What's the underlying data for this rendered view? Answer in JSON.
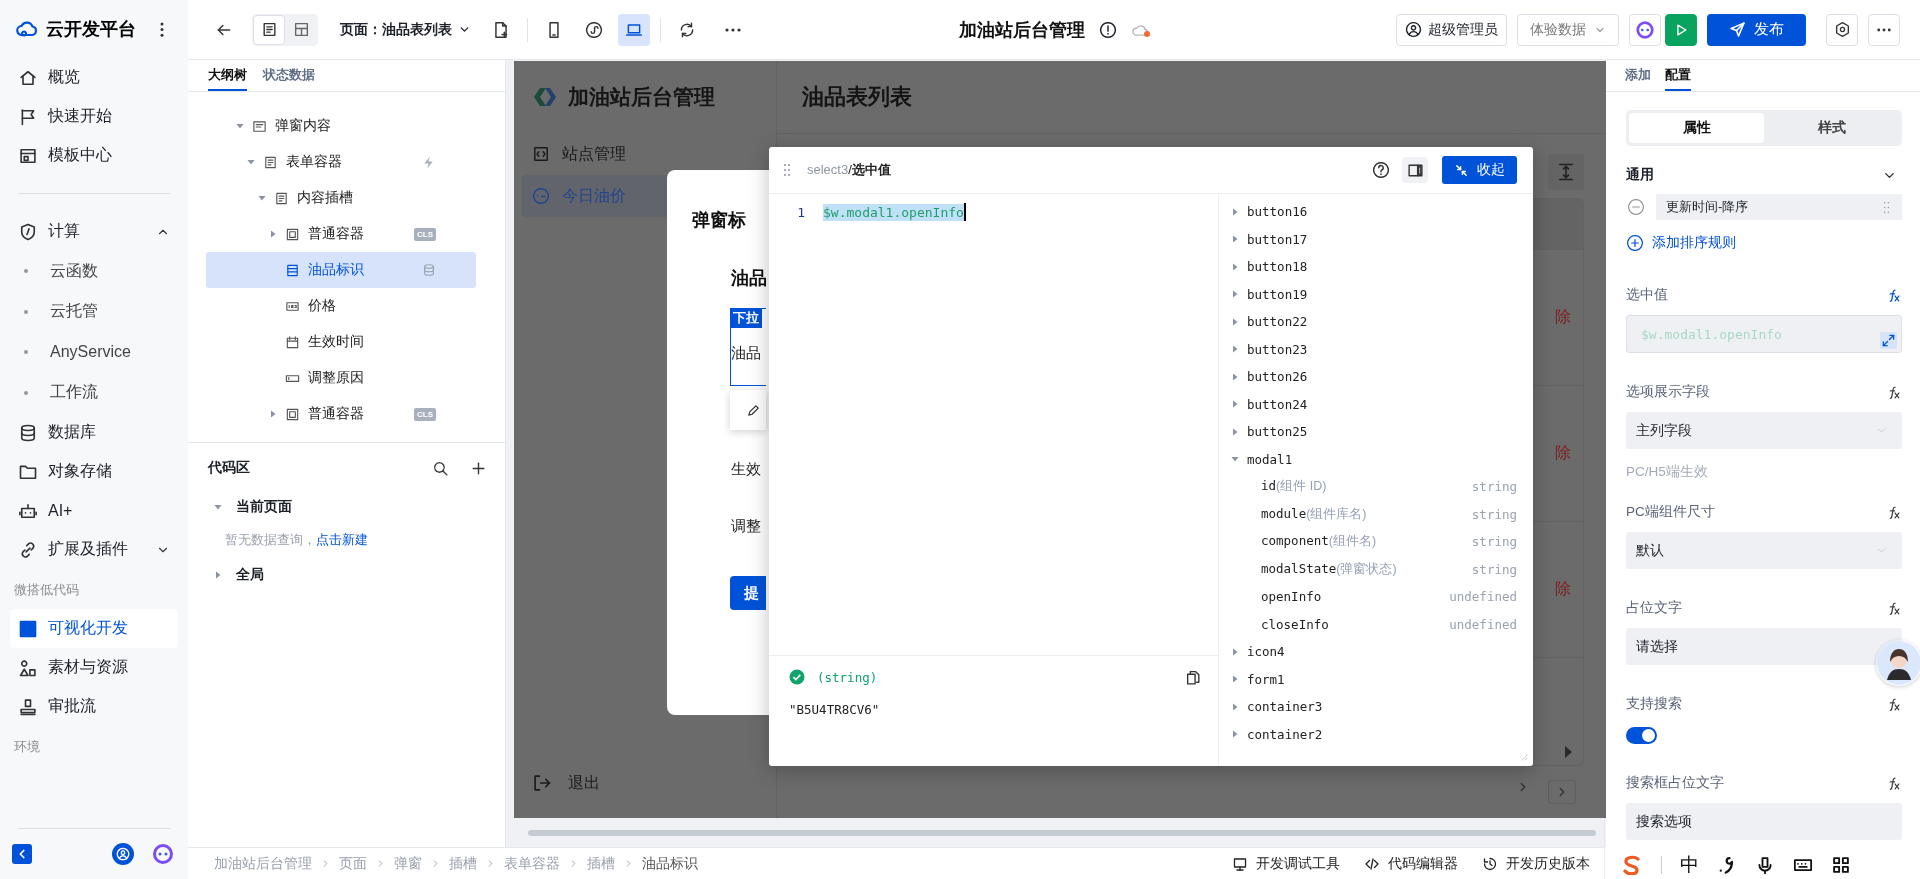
{
  "brand": {
    "name": "云开发平台"
  },
  "nav_top": [
    {
      "label": "概览",
      "selected": false
    },
    {
      "label": "快速开始",
      "selected": false
    },
    {
      "label": "模板中心",
      "selected": false
    }
  ],
  "nav_main": [
    {
      "label": "计算",
      "selected": false,
      "expanded": true,
      "children": [
        {
          "label": "云函数",
          "selected": false
        },
        {
          "label": "云托管",
          "selected": false
        },
        {
          "label": "AnyService",
          "selected": false
        },
        {
          "label": "工作流",
          "selected": false
        }
      ]
    },
    {
      "label": "数据库",
      "selected": false
    },
    {
      "label": "对象存储",
      "selected": false
    },
    {
      "label": "AI+",
      "selected": false
    },
    {
      "label": "扩展及插件",
      "selected": false,
      "expanded": false
    }
  ],
  "nav_sections": [
    {
      "title": "微搭低代码",
      "items": [
        {
          "label": "可视化开发",
          "selected": true
        },
        {
          "label": "素材与资源",
          "selected": false
        },
        {
          "label": "审批流",
          "selected": false
        }
      ]
    },
    {
      "title": "环境"
    }
  ],
  "toolbar": {
    "view_modes": [
      {
        "selected": true
      },
      {
        "selected": false
      }
    ],
    "page_prefix": "页面：",
    "page": "油品表列表",
    "devices": [
      {
        "selected": false
      },
      {
        "selected": false
      },
      {
        "selected": true
      }
    ],
    "app_title": "加油站后台管理",
    "sync_pending": true,
    "role": "超级管理员",
    "data_mode": "体验数据",
    "publish": "发布"
  },
  "outline": {
    "tabs": [
      {
        "label": "大纲树",
        "selected": true
      },
      {
        "label": "状态数据",
        "selected": false
      }
    ],
    "tree": [
      {
        "label": "弹窗内容",
        "kind": "dialog",
        "selected": false,
        "expanded": true,
        "children": [
          {
            "label": "表单容器",
            "kind": "form",
            "selected": false,
            "expanded": true,
            "has_event": true,
            "children": [
              {
                "label": "内容插槽",
                "kind": "slot",
                "selected": false,
                "expanded": true,
                "children": [
                  {
                    "label": "普通容器",
                    "kind": "container",
                    "selected": false,
                    "expanded": false,
                    "badge": "CLS"
                  },
                  {
                    "label": "油品标识",
                    "kind": "select",
                    "selected": true,
                    "has_data_source": true
                  },
                  {
                    "label": "价格",
                    "kind": "number",
                    "selected": false
                  },
                  {
                    "label": "生效时间",
                    "kind": "date",
                    "selected": false
                  },
                  {
                    "label": "调整原因",
                    "kind": "input",
                    "selected": false
                  },
                  {
                    "label": "普通容器",
                    "kind": "container",
                    "selected": false,
                    "expanded": false,
                    "badge": "CLS"
                  }
                ]
              }
            ]
          }
        ]
      }
    ]
  },
  "code_area": {
    "title": "代码区",
    "groups": [
      {
        "label": "当前页面",
        "expanded": true,
        "empty_text": "暂无数据查询，",
        "empty_link": "点击新建"
      },
      {
        "label": "全局",
        "expanded": false
      }
    ]
  },
  "breadcrumb": [
    "加油站后台管理",
    "页面",
    "弹窗",
    "插槽",
    "表单容器",
    "插槽",
    "油品标识"
  ],
  "dev_tools": [
    "开发调试工具",
    "代码编辑器",
    "开发历史版本"
  ],
  "preview": {
    "app_name": "加油站后台管理",
    "menu": [
      {
        "label": "站点管理",
        "selected": false
      },
      {
        "label": "今日油价",
        "selected": true
      }
    ],
    "logout": "退出",
    "page_title": "油品表列表",
    "row_actions": [
      "除",
      "除",
      "除"
    ]
  },
  "modal": {
    "title": "弹窗标",
    "section": "油品",
    "field_tag": "下拉",
    "field_label": "油品",
    "rows": [
      "生效",
      "调整"
    ],
    "submit": "提"
  },
  "expression_editor": {
    "target": "select3",
    "separator": "/",
    "prop": "选中值",
    "collapse": "收起",
    "lines": [
      {
        "number": "1",
        "code": "$w.modal1.openInfo",
        "selected": true
      }
    ],
    "result": {
      "valid": true,
      "type": "(string)",
      "value": "\"B5U4TR8CV6\""
    },
    "tree": [
      {
        "name": "button16",
        "expanded": false
      },
      {
        "name": "button17",
        "expanded": false
      },
      {
        "name": "button18",
        "expanded": false
      },
      {
        "name": "button19",
        "expanded": false
      },
      {
        "name": "button22",
        "expanded": false
      },
      {
        "name": "button23",
        "expanded": false
      },
      {
        "name": "button26",
        "expanded": false
      },
      {
        "name": "button24",
        "expanded": false
      },
      {
        "name": "button25",
        "expanded": false
      },
      {
        "name": "modal1",
        "expanded": true,
        "children": [
          {
            "name": "id",
            "hint": "(组件 ID)",
            "type": "string"
          },
          {
            "name": "module",
            "hint": "(组件库名)",
            "type": "string"
          },
          {
            "name": "component",
            "hint": "(组件名)",
            "type": "string"
          },
          {
            "name": "modalState",
            "hint": "(弹窗状态)",
            "type": "string"
          },
          {
            "name": "openInfo",
            "type": "undefined"
          },
          {
            "name": "closeInfo",
            "type": "undefined"
          }
        ]
      },
      {
        "name": "icon4",
        "expanded": false
      },
      {
        "name": "form1",
        "expanded": false
      },
      {
        "name": "container3",
        "expanded": false
      },
      {
        "name": "container2",
        "expanded": false
      }
    ]
  },
  "config": {
    "tabs": [
      {
        "label": "添加",
        "selected": false
      },
      {
        "label": "配置",
        "selected": true
      }
    ],
    "modes": [
      {
        "label": "属性",
        "selected": true
      },
      {
        "label": "样式",
        "selected": false
      }
    ],
    "section": {
      "title": "通用",
      "expanded": true
    },
    "sort_rules": [
      "更新时间-降序"
    ],
    "add_rule": "添加排序规则",
    "fields": [
      {
        "kind": "expression",
        "label": "选中值",
        "bound": true,
        "value": "$w.modal1.openInfo"
      },
      {
        "kind": "select",
        "label": "选项展示字段",
        "bound": false,
        "value": "主列字段",
        "hint": "PC/H5端生效"
      },
      {
        "kind": "select",
        "label": "PC端组件尺寸",
        "bound": false,
        "value": "默认"
      },
      {
        "kind": "input",
        "label": "占位文字",
        "bound": false,
        "value": "请选择"
      },
      {
        "kind": "toggle",
        "label": "支持搜索",
        "bound": false,
        "on": true
      },
      {
        "kind": "input",
        "label": "搜索框占位文字",
        "bound": false,
        "value": "搜索选项"
      }
    ]
  },
  "ime": {
    "mode": "中"
  }
}
